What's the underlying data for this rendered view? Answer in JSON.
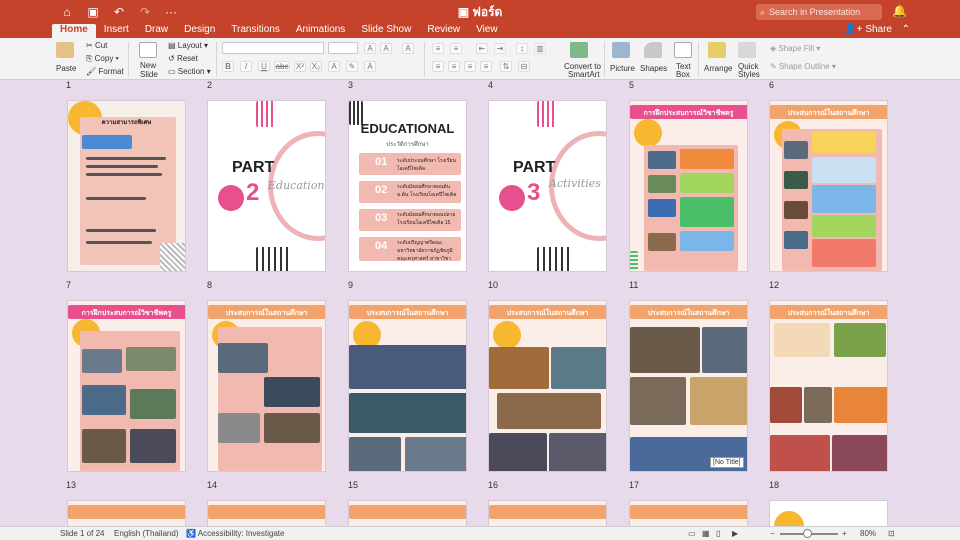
{
  "titlebar": {
    "filename": "ฟอร์ด",
    "search_placeholder": "Search in Presentation",
    "icons": [
      "home-icon",
      "save-icon",
      "undo-icon",
      "redo-icon",
      "more-icon"
    ]
  },
  "tabs": [
    "Home",
    "Insert",
    "Draw",
    "Design",
    "Transitions",
    "Animations",
    "Slide Show",
    "Review",
    "View"
  ],
  "active_tab": "Home",
  "share_label": "Share",
  "ribbon": {
    "paste": "Paste",
    "cut": "Cut",
    "copy": "Copy",
    "format": "Format",
    "new_slide_1": "New",
    "new_slide_2": "Slide",
    "layout": "Layout",
    "reset": "Reset",
    "section": "Section",
    "convert_1": "Convert to",
    "convert_2": "SmartArt",
    "picture": "Picture",
    "shapes": "Shapes",
    "textbox_1": "Text",
    "textbox_2": "Box",
    "arrange": "Arrange",
    "quick_1": "Quick",
    "quick_2": "Styles",
    "shape_fill": "Shape Fill",
    "shape_outline": "Shape Outline",
    "format_buttons": [
      "B",
      "I",
      "U",
      "abc",
      "X²",
      "X₂"
    ]
  },
  "slides": {
    "row1_numbers": [
      "1",
      "2",
      "3",
      "4",
      "5",
      "6"
    ],
    "row2_numbers": [
      "7",
      "8",
      "9",
      "10",
      "11",
      "12"
    ],
    "row3_numbers": [
      "13",
      "14",
      "15",
      "16",
      "17",
      "18"
    ],
    "s1_title": "ความสามารถพิเศษ",
    "s2_part": "PART",
    "s2_num": "2",
    "s2_script": "Educational",
    "s3_title": "EDUCATIONAL",
    "s3_sub": "ประวัติการศึกษา",
    "s3_items": [
      {
        "num": "01",
        "text": "ระดับประถมศึกษา โรงเรียนโอเคปีไซเคิ่ล"
      },
      {
        "num": "02",
        "text": "ระดับมัธยมศึกษาตอนต้น ม.ต้น โรงเรียนโอเคปีไซเคิ่ล"
      },
      {
        "num": "03",
        "text": "ระดับมัธยมศึกษาตอนปลาย โรงเรียนโอเคปีไซเคิ่ล 15"
      },
      {
        "num": "04",
        "text": "ระดับปริญญาตรีคณะ มหาวิทยาลัยราชภัฏชัยภูมิ คณะครุศาสตร์ สาขาวิชา"
      }
    ],
    "s4_part": "PART",
    "s4_num": "3",
    "s4_script": "Activities",
    "s5_title": "การฝึกประสบการณ์วิชาชีพครู",
    "s6_title": "ประสบการณ์ในสถานศึกษา",
    "s7_title": "การฝึกประสบการณ์วิชาชีพครู",
    "s8_title": "ประสบการณ์ในสถานศึกษา",
    "s9_title": "ประสบการณ์ในสถานศึกษา",
    "s10_title": "ประสบการณ์ในสถานศึกษา",
    "s11_title": "ประสบการณ์ในสถานศึกษา",
    "s12_title": "ประสบการณ์ในสถานศึกษา",
    "s11_no_title": "[No Title]"
  },
  "status": {
    "slide_of": "Slide 1 of 24",
    "language": "English (Thailand)",
    "accessibility": "Accessibility: Investigate",
    "zoom": "80%"
  },
  "colors": {
    "accent": "#c4432a",
    "pink": "#f2b9b0",
    "orange_title": "#f2a36b",
    "magenta_title": "#e8508d",
    "yellow": "#f7b731"
  }
}
